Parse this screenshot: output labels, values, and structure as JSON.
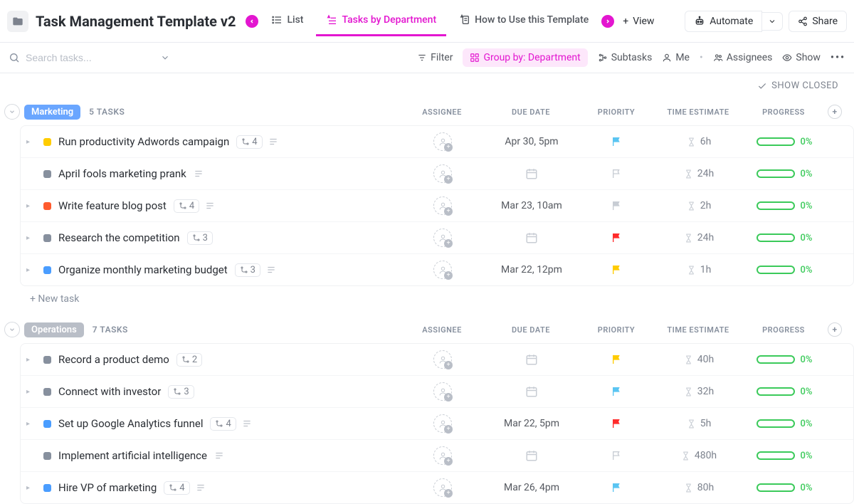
{
  "header": {
    "title": "Task Management Template v2",
    "tabs": {
      "list": "List",
      "tasksByDept": "Tasks by Department",
      "howTo": "How to Use this Template"
    },
    "addView": "View",
    "automate": "Automate",
    "share": "Share"
  },
  "toolbar": {
    "searchPlaceholder": "Search tasks...",
    "filter": "Filter",
    "groupBy": "Group by: Department",
    "subtasks": "Subtasks",
    "me": "Me",
    "assignees": "Assignees",
    "show": "Show"
  },
  "showClosed": "SHOW CLOSED",
  "columns": {
    "assignee": "ASSIGNEE",
    "dueDate": "DUE DATE",
    "priority": "PRIORITY",
    "timeEstimate": "TIME ESTIMATE",
    "progress": "PROGRESS"
  },
  "newTask": "+ New task",
  "groups": [
    {
      "name": "Marketing",
      "pillClass": "pill-marketing",
      "count": "5 TASKS",
      "tasks": [
        {
          "caret": true,
          "status": "#ffcc00",
          "name": "Run productivity Adwords campaign",
          "subtasks": "4",
          "desc": true,
          "due": "Apr 30, 5pm",
          "flag": "#5bc5f2",
          "flagFilled": true,
          "time": "6h",
          "progress": "0%"
        },
        {
          "caret": false,
          "status": "#87909e",
          "name": "April fools marketing prank",
          "subtasks": "",
          "desc": true,
          "due": "",
          "flag": "",
          "flagFilled": false,
          "time": "24h",
          "progress": "0%"
        },
        {
          "caret": true,
          "status": "#ff5b2e",
          "name": "Write feature blog post",
          "subtasks": "4",
          "desc": true,
          "due": "Mar 23, 10am",
          "flag": "#c8cdd4",
          "flagFilled": true,
          "time": "2h",
          "progress": "0%"
        },
        {
          "caret": true,
          "status": "#87909e",
          "name": "Research the competition",
          "subtasks": "3",
          "desc": false,
          "due": "",
          "flag": "#ff2b2b",
          "flagFilled": true,
          "time": "24h",
          "progress": "0%"
        },
        {
          "caret": true,
          "status": "#4a9dff",
          "name": "Organize monthly marketing budget",
          "subtasks": "3",
          "desc": true,
          "due": "Mar 22, 12pm",
          "flag": "#ffcc00",
          "flagFilled": true,
          "time": "1h",
          "progress": "0%"
        }
      ]
    },
    {
      "name": "Operations",
      "pillClass": "pill-operations",
      "count": "7 TASKS",
      "tasks": [
        {
          "caret": true,
          "status": "#87909e",
          "name": "Record a product demo",
          "subtasks": "2",
          "desc": false,
          "due": "",
          "flag": "#ffcc00",
          "flagFilled": true,
          "time": "40h",
          "progress": "0%"
        },
        {
          "caret": true,
          "status": "#87909e",
          "name": "Connect with investor",
          "subtasks": "3",
          "desc": false,
          "due": "",
          "flag": "#5bc5f2",
          "flagFilled": true,
          "time": "32h",
          "progress": "0%"
        },
        {
          "caret": true,
          "status": "#4a9dff",
          "name": "Set up Google Analytics funnel",
          "subtasks": "4",
          "desc": true,
          "due": "Mar 22, 5pm",
          "flag": "#ff2b2b",
          "flagFilled": true,
          "time": "5h",
          "progress": "0%"
        },
        {
          "caret": false,
          "status": "#87909e",
          "name": "Implement artificial intelligence",
          "subtasks": "",
          "desc": true,
          "due": "",
          "flag": "",
          "flagFilled": false,
          "time": "480h",
          "progress": "0%"
        },
        {
          "caret": true,
          "status": "#4a9dff",
          "name": "Hire VP of marketing",
          "subtasks": "4",
          "desc": true,
          "due": "Mar 26, 4pm",
          "flag": "#5bc5f2",
          "flagFilled": true,
          "time": "80h",
          "progress": "0%"
        }
      ]
    }
  ]
}
